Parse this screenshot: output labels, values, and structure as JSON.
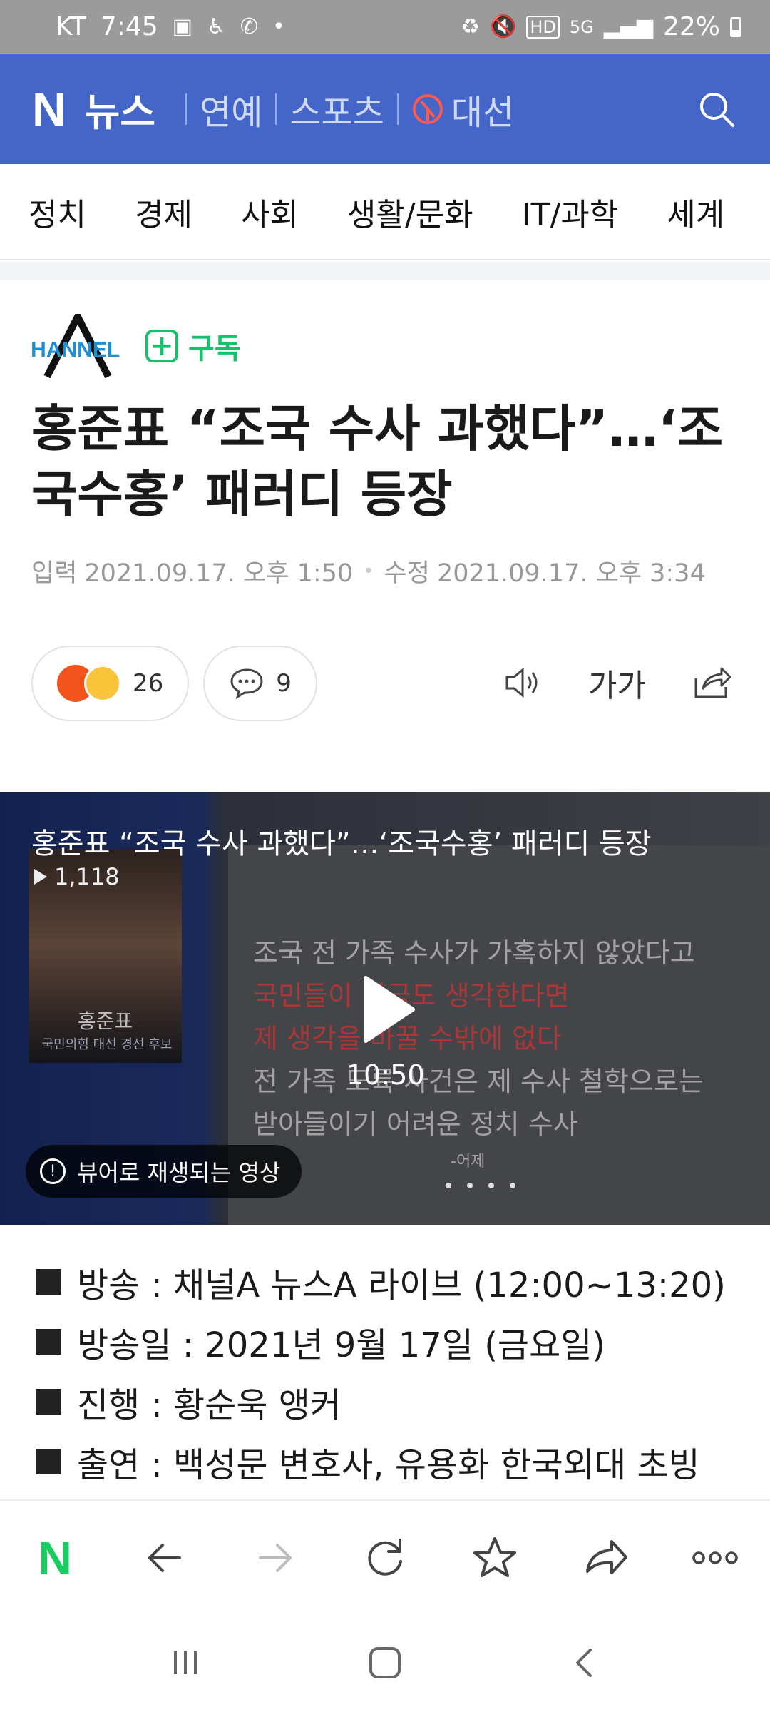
{
  "status_bar": {
    "carrier": "KT",
    "time": "7:45",
    "network": "5G",
    "battery": "22%"
  },
  "header": {
    "logo": "N",
    "service": "뉴스",
    "links": [
      "연예",
      "스포츠",
      "대선"
    ],
    "brand_color": "#4366c8"
  },
  "categories": [
    "정치",
    "경제",
    "사회",
    "생활/문화",
    "IT/과학",
    "세계"
  ],
  "article": {
    "press": "CHANNEL A",
    "subscribe_label": "구독",
    "title": "홍준표 “조국 수사 과했다”…‘조국수홍’ 패러디 등장",
    "input_label": "입력",
    "input_date": "2021.09.17. 오후 1:50",
    "modified_label": "수정",
    "modified_date": "2021.09.17. 오후 3:34",
    "reaction_count": "26",
    "comment_count": "9",
    "font_size_label": "가가"
  },
  "video": {
    "title": "홍준표 “조국 수사 과했다”…‘조국수홍’ 패러디 등장",
    "views": "1,118",
    "duration": "10:50",
    "viewer_note": "뷰어로 재생되는 영상",
    "person_name": "홍준표",
    "person_caption": "국민의힘 대선 경선 후보",
    "board_lines": [
      "조국 전 가족 수사가 가혹하지 않았다고",
      "국민들이 지금도 생각한다면",
      "제 생각을 바꿀 수밖에 없다",
      "전 가족 도륙 사건은 제 수사 철학으로는",
      "받아들이기 어려운 정치 수사"
    ],
    "board_footer": "-어제"
  },
  "body_lines": [
    "방송 : 채널A 뉴스A 라이브 (12:00~13:20)",
    "방송일 : 2021년 9월 17일 (금요일)",
    "진행 : 황순욱 앵커",
    "출연 : 백성문 변호사, 유용화 한국외대 초빙"
  ],
  "accent_green": "#13c26b"
}
